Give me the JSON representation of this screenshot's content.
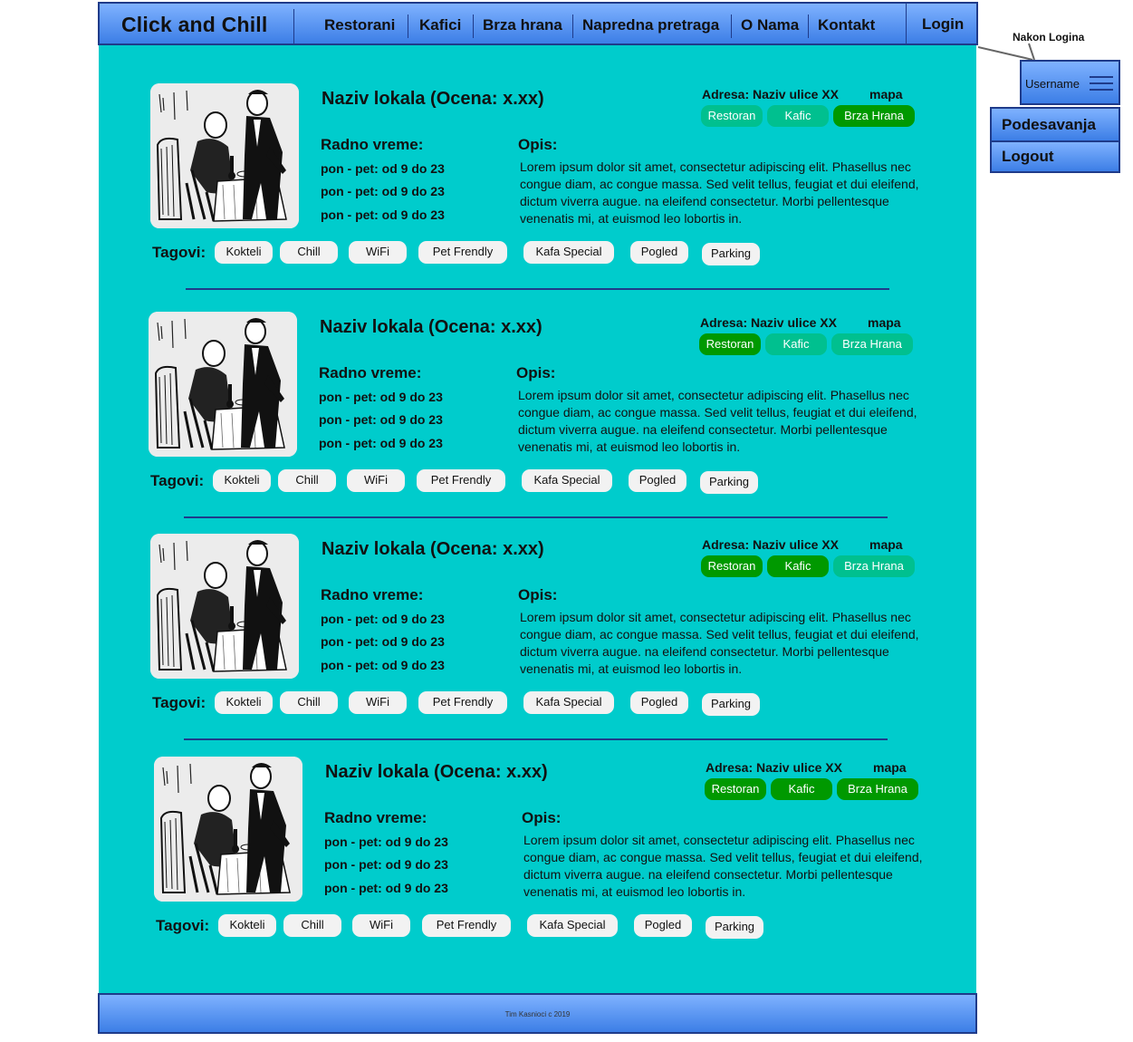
{
  "header": {
    "brand": "Click and Chill",
    "nav": [
      "Restorani",
      "Kafici",
      "Brza hrana",
      "Napredna pretraga",
      "O Nama",
      "Kontakt"
    ],
    "login": "Login"
  },
  "listings": [
    {
      "title": "Naziv lokala (Ocena: x.xx)",
      "address": "Adresa: Naziv ulice XX",
      "map": "mapa",
      "types": [
        {
          "label": "Restoran",
          "active": false
        },
        {
          "label": "Kafic",
          "active": false
        },
        {
          "label": "Brza Hrana",
          "active": true
        }
      ],
      "hours_label": "Radno vreme:",
      "hours": [
        "pon - pet: od 9 do 23",
        "pon - pet: od 9 do 23",
        "pon - pet: od 9 do 23"
      ],
      "desc_label": "Opis:",
      "description": "Lorem ipsum dolor sit amet, consectetur adipiscing elit. Phasellus nec congue diam, ac congue massa. Sed velit tellus, feugiat et dui eleifend, dictum viverra augue. na eleifend consectetur. Morbi pellentesque venenatis mi, at euismod leo lobortis in.",
      "tags_label": "Tagovi:",
      "tags": [
        "Kokteli",
        "Chill",
        "WiFi",
        "Pet Frendly",
        "Kafa Special",
        "Pogled",
        "Parking"
      ]
    },
    {
      "title": "Naziv lokala (Ocena: x.xx)",
      "address": "Adresa: Naziv ulice XX",
      "map": "mapa",
      "types": [
        {
          "label": "Restoran",
          "active": true
        },
        {
          "label": "Kafic",
          "active": false
        },
        {
          "label": "Brza Hrana",
          "active": false
        }
      ],
      "hours_label": "Radno vreme:",
      "hours": [
        "pon - pet: od 9 do 23",
        "pon - pet: od 9 do 23",
        "pon - pet: od 9 do 23"
      ],
      "desc_label": "Opis:",
      "description": "Lorem ipsum dolor sit amet, consectetur adipiscing elit. Phasellus nec congue diam, ac congue massa. Sed velit tellus, feugiat et dui eleifend, dictum viverra augue. na eleifend consectetur. Morbi pellentesque venenatis mi, at euismod leo lobortis in.",
      "tags_label": "Tagovi:",
      "tags": [
        "Kokteli",
        "Chill",
        "WiFi",
        "Pet Frendly",
        "Kafa Special",
        "Pogled",
        "Parking"
      ]
    },
    {
      "title": "Naziv lokala (Ocena: x.xx)",
      "address": "Adresa: Naziv ulice XX",
      "map": "mapa",
      "types": [
        {
          "label": "Restoran",
          "active": true
        },
        {
          "label": "Kafic",
          "active": true
        },
        {
          "label": "Brza Hrana",
          "active": false
        }
      ],
      "hours_label": "Radno vreme:",
      "hours": [
        "pon - pet: od 9 do 23",
        "pon - pet: od 9 do 23",
        "pon - pet: od 9 do 23"
      ],
      "desc_label": "Opis:",
      "description": "Lorem ipsum dolor sit amet, consectetur adipiscing elit. Phasellus nec congue diam, ac congue massa. Sed velit tellus, feugiat et dui eleifend, dictum viverra augue. na eleifend consectetur. Morbi pellentesque venenatis mi, at euismod leo lobortis in.",
      "tags_label": "Tagovi:",
      "tags": [
        "Kokteli",
        "Chill",
        "WiFi",
        "Pet Frendly",
        "Kafa Special",
        "Pogled",
        "Parking"
      ]
    },
    {
      "title": "Naziv lokala (Ocena: x.xx)",
      "address": "Adresa: Naziv ulice XX",
      "map": "mapa",
      "types": [
        {
          "label": "Restoran",
          "active": true
        },
        {
          "label": "Kafic",
          "active": true
        },
        {
          "label": "Brza Hrana",
          "active": true
        }
      ],
      "hours_label": "Radno vreme:",
      "hours": [
        "pon - pet: od 9 do 23",
        "pon - pet: od 9 do 23",
        "pon - pet: od 9 do 23"
      ],
      "desc_label": "Opis:",
      "description": "Lorem ipsum dolor sit amet, consectetur adipiscing elit. Phasellus nec congue diam, ac congue massa. Sed velit tellus, feugiat et dui eleifend, dictum viverra augue. na eleifend consectetur. Morbi pellentesque venenatis mi, at euismod leo lobortis in.",
      "tags_label": "Tagovi:",
      "tags": [
        "Kokteli",
        "Chill",
        "WiFi",
        "Pet Frendly",
        "Kafa Special",
        "Pogled",
        "Parking"
      ]
    }
  ],
  "footer": {
    "text": "Tim Kasnioci  c  2019"
  },
  "annotation": {
    "note": "Nakon Logina",
    "username": "Username",
    "menu": [
      "Podesavanja",
      "Logout"
    ]
  },
  "colors": {
    "header_gradient_top": "#7fb2ff",
    "header_gradient_bottom": "#3c7ee6",
    "content_bg": "#00cccc",
    "type_active": "#009900",
    "type_inactive": "#00c08f",
    "tag_bg": "#f2f2f2",
    "border": "#1f3b8a"
  },
  "icons": {
    "menu": "hamburger-icon",
    "photo": "restaurant-illustration"
  }
}
